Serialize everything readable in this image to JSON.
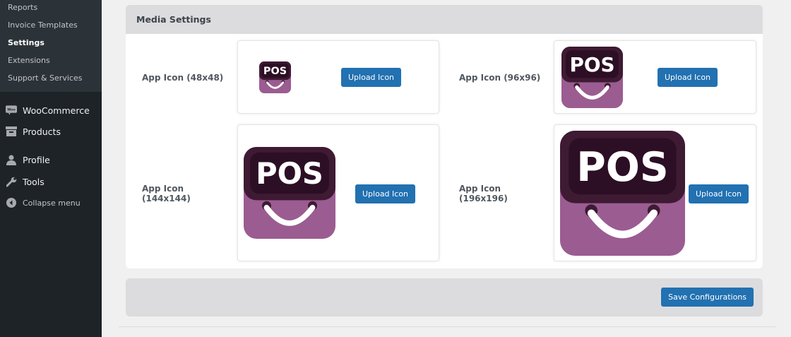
{
  "sidebar": {
    "submenu": [
      "Reports",
      "Invoice Templates",
      "Settings",
      "Extensions",
      "Support & Services"
    ],
    "current": "Settings",
    "menu": {
      "woocommerce": "WooCommerce",
      "products": "Products",
      "profile": "Profile",
      "tools": "Tools",
      "collapse": "Collapse menu"
    },
    "woo_badge": "Woo"
  },
  "media": {
    "title": "Media Settings",
    "icons": [
      {
        "label": "App Icon (48x48)",
        "button": "Upload Icon"
      },
      {
        "label": "App Icon (96x96)",
        "button": "Upload Icon"
      },
      {
        "label": "App Icon (144x144)",
        "button": "Upload Icon"
      },
      {
        "label": "App Icon (196x196)",
        "button": "Upload Icon"
      }
    ],
    "logo_text": "POS"
  },
  "actions": {
    "save": "Save Configurations"
  },
  "colors": {
    "accent": "#2271b1",
    "icon_purple": "#9b5c91",
    "icon_dark": "#3e1a33",
    "icon_darker": "#2c0f24"
  }
}
